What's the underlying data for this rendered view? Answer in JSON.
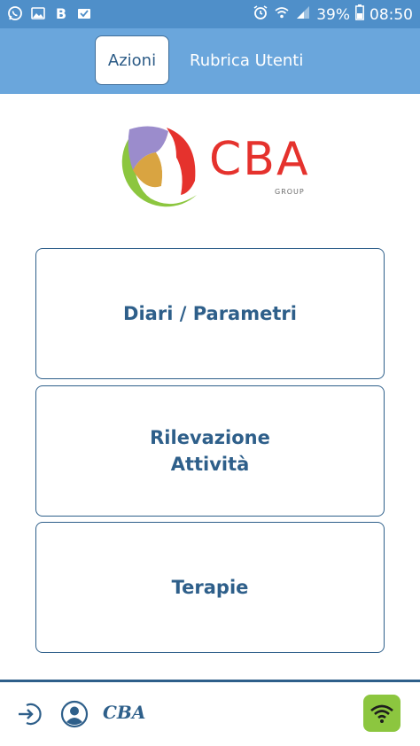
{
  "status_bar": {
    "battery": "39%",
    "time": "08:50",
    "b_label": "B"
  },
  "tabs": [
    {
      "label": "Azioni",
      "selected": true
    },
    {
      "label": "Rubrica Utenti",
      "selected": false
    }
  ],
  "logo": {
    "text": "CBA",
    "subtext": "GROUP"
  },
  "actions": [
    {
      "label": "Diari / Parametri"
    },
    {
      "label": "Rilevazione\nAttività"
    },
    {
      "label": "Terapie"
    }
  ],
  "bottom_bar": {
    "brand": "CBA"
  },
  "colors": {
    "status_bar": "#4f8fc9",
    "tab_bar": "#6aa6dc",
    "primary": "#2e5f8a",
    "logo_red": "#e5322d",
    "wifi_green": "#8cc63f"
  }
}
